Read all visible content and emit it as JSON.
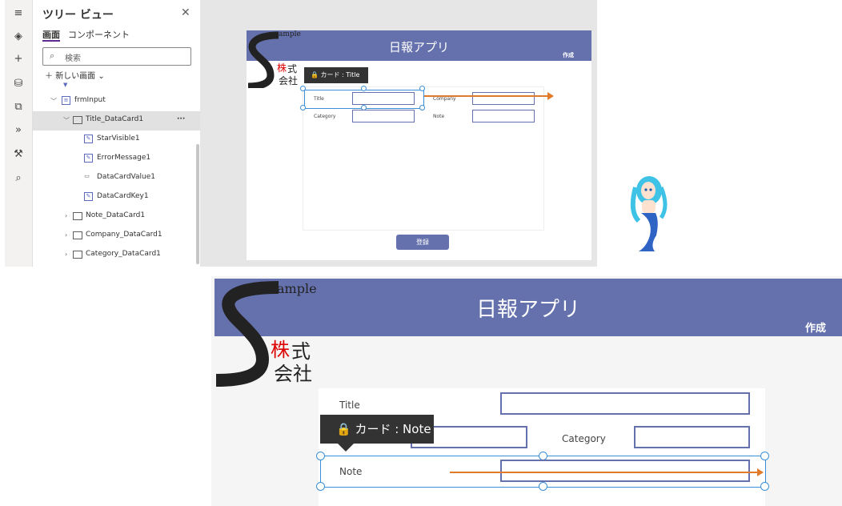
{
  "rail": {
    "icons": [
      "hamburger-icon",
      "layers-icon",
      "plus-icon",
      "database-icon",
      "media-icon",
      "flow-icon",
      "tools-icon",
      "search-icon"
    ]
  },
  "tree": {
    "title": "ツリー ビュー",
    "tabs": [
      "画面",
      "コンポーネント"
    ],
    "search_placeholder": "検索",
    "new_screen": "新しい画面",
    "nodes": [
      "frmInput",
      "Title_DataCard1",
      "StarVisible1",
      "ErrorMessage1",
      "DataCardValue1",
      "DataCardKey1",
      "Note_DataCard1",
      "Company_DataCard1",
      "Category_DataCard1"
    ],
    "more": "···"
  },
  "app": {
    "title": "日報アプリ",
    "create": "作成",
    "logo_sample": "ample",
    "logo_kabu": "株",
    "logo_shiki": "式",
    "logo_kaisha": "会社",
    "submit": "登録",
    "labels": {
      "title": "Title",
      "company": "Company",
      "category": "Category",
      "note": "Note"
    }
  },
  "tooltips": {
    "top": "カード : Title",
    "bottom": "カード : Note"
  },
  "colors": {
    "header": "#6571ac",
    "arrow": "#e07b2c",
    "selection": "#3a8fd8"
  }
}
